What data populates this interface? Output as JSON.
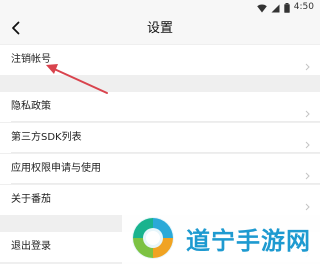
{
  "status_bar": {
    "time": "4:50"
  },
  "header": {
    "title": "设置"
  },
  "settings": {
    "items": [
      {
        "label": "注销帐号"
      },
      {
        "label": "隐私政策"
      },
      {
        "label": "第三方SDK列表"
      },
      {
        "label": "应用权限申请与使用"
      },
      {
        "label": "关于番茄"
      },
      {
        "label": "退出登录"
      }
    ]
  },
  "annotation": {
    "arrow_color": "#d9434d"
  },
  "watermark": {
    "text": "道宁手游网"
  }
}
